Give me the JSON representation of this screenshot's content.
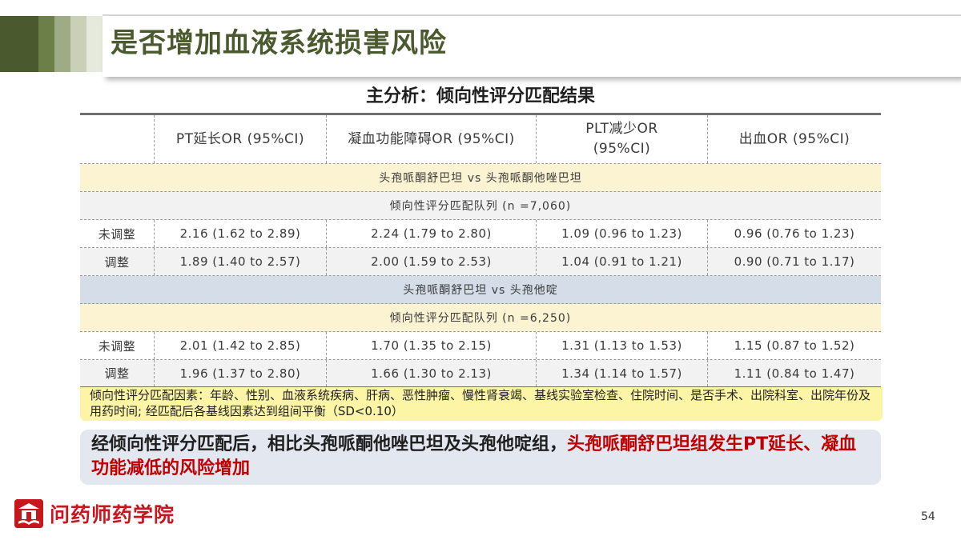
{
  "header": {
    "title": "是否增加血液系统损害风险"
  },
  "subtitle": "主分析：倾向性评分匹配结果",
  "table": {
    "columns": [
      "",
      "PT延长OR (95%CI)",
      "凝血功能障碍OR (95%CI)",
      "PLT减少OR",
      "(95%CI)",
      "出血OR (95%CI)"
    ],
    "group1": {
      "title": "头孢哌酮舒巴坦 vs 头孢哌酮他唑巴坦",
      "cohort": "倾向性评分匹配队列 (n =7,060)",
      "rows": [
        [
          "未调整",
          "2.16 (1.62 to 2.89)",
          "2.24 (1.79 to 2.80)",
          "1.09 (0.96 to 1.23)",
          "0.96 (0.76 to 1.23)"
        ],
        [
          "调整",
          "1.89 (1.40 to 2.57)",
          "2.00 (1.59 to 2.53)",
          "1.04 (0.91 to 1.21)",
          "0.90 (0.71 to 1.17)"
        ]
      ]
    },
    "group2": {
      "title": "头孢哌酮舒巴坦 vs 头孢他啶",
      "cohort": "倾向性评分匹配队列 (n =6,250)",
      "rows": [
        [
          "未调整",
          "2.01 (1.42 to 2.85)",
          "1.70 (1.35 to 2.15)",
          "1.31 (1.13 to 1.53)",
          "1.15 (0.87 to 1.52)"
        ],
        [
          "调整",
          "1.96 (1.37 to 2.80)",
          "1.66 (1.30 to 2.13)",
          "1.34 (1.14 to 1.57)",
          "1.11 (0.84 to 1.47)"
        ]
      ]
    }
  },
  "note": "倾向性评分匹配因素：年龄、性别、血液系统疾病、肝病、恶性肿瘤、慢性肾衰竭、基线实验室检查、住院时间、是否手术、出院科室、出院年份及用药时间; 经匹配后各基线因素达到组间平衡（SD<0.10）",
  "conclusion": {
    "normal": "经倾向性评分匹配后，相比头孢哌酮他唑巴坦及头孢他啶组，",
    "highlight": "头孢哌酮舒巴坦组发生PT延长、凝血功能减低的风险增加"
  },
  "footer": {
    "logo_text": "问药师药学院",
    "page_number": "54"
  },
  "colors": {
    "accent_green": "#4a5a2e",
    "highlight_red": "#c00000",
    "logo_red": "#c8161d"
  }
}
